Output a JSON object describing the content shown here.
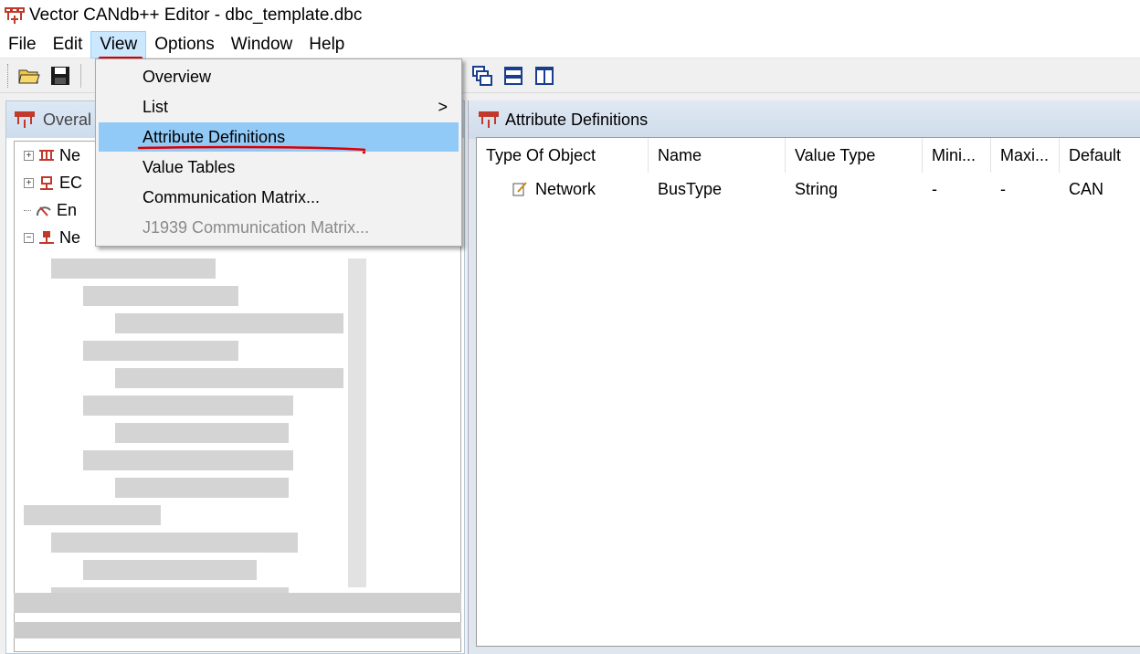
{
  "window": {
    "title": "Vector CANdb++ Editor - dbc_template.dbc"
  },
  "menubar": {
    "items": [
      "File",
      "Edit",
      "View",
      "Options",
      "Window",
      "Help"
    ],
    "active": "View"
  },
  "view_menu": {
    "items": [
      {
        "label": "Overview",
        "state": "normal"
      },
      {
        "label": "List",
        "state": "submenu",
        "arrow": ">"
      },
      {
        "label": "Attribute Definitions",
        "state": "highlighted"
      },
      {
        "label": "Value Tables",
        "state": "normal"
      },
      {
        "label": "Communication Matrix...",
        "state": "normal"
      },
      {
        "label": "J1939 Communication Matrix...",
        "state": "disabled"
      }
    ]
  },
  "left_panel": {
    "title": "Overal",
    "tree": [
      {
        "label": "Ne",
        "expander": "+",
        "icon": "networks-icon"
      },
      {
        "label": "EC",
        "expander": "+",
        "icon": "ecu-icon"
      },
      {
        "label": "En",
        "expander": "",
        "icon": "environment-variable-icon"
      },
      {
        "label": "Ne",
        "expander": "−",
        "icon": "network-node-icon"
      }
    ]
  },
  "right_panel": {
    "title": "Attribute Definitions",
    "columns": [
      "Type Of Object",
      "Name",
      "Value Type",
      "Mini...",
      "Maxi...",
      "Default"
    ],
    "rows": [
      {
        "type_of_object": "Network",
        "name": "BusType",
        "value_type": "String",
        "min": "-",
        "max": "-",
        "default": "CAN"
      }
    ]
  },
  "colors": {
    "highlight": "#91c9f7",
    "menu_active": "#cce8ff",
    "annotation_red": "#dd0000"
  }
}
